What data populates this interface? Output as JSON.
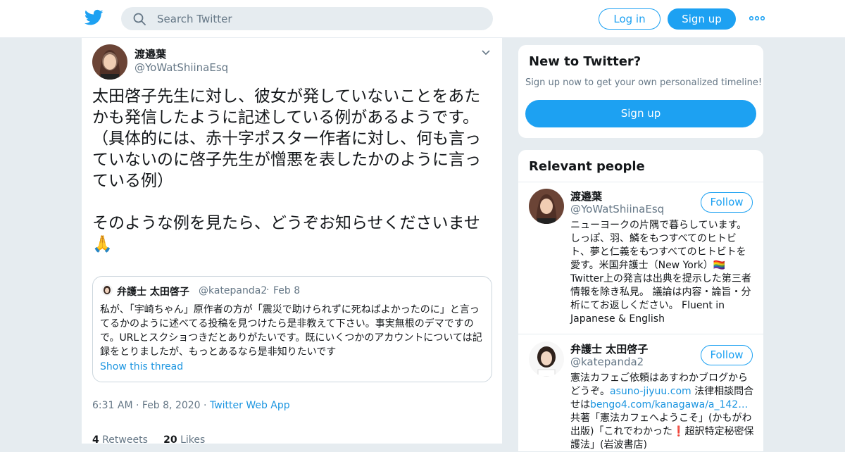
{
  "header": {
    "search_placeholder": "Search Twitter",
    "login_label": "Log in",
    "signup_label": "Sign up",
    "brand_color": "#1da1f2"
  },
  "tweet": {
    "author_name": "渡邉葉",
    "author_handle": "@YoWatShiinaEsq",
    "text": "太田啓子先生に対し、彼女が発していないことをあたかも発信したように記述している例があるようです。（具体的には、赤十字ポスター作者に対し、何も言っていないのに啓子先生が憎悪を表したかのように言っている例）\n\nそのような例を見たら、どうぞお知らせくださいませ🙏",
    "time": "6:31 AM",
    "date": "Feb 8, 2020",
    "source": "Twitter Web App",
    "retweets": "4",
    "retweets_label": "Retweets",
    "likes": "20",
    "likes_label": "Likes"
  },
  "quoted": {
    "name": "弁護士 太田啓子",
    "handle": "@katepanda2",
    "date": "Feb 8",
    "text": "私が、「宇崎ちゃん」原作者の方が「震災で助けられずに死ねばよかったのに」と言ってるかのように述べてる投稿を見つけたら是非教えて下さい。事実無根のデマですので。URLとスクショつきだとありがたいです。既にいくつかのアカウントについては記録をとりましたが、もっとあるなら是非知りたいです",
    "show_thread": "Show this thread"
  },
  "sidebar": {
    "new_title": "New to Twitter?",
    "new_sub": "Sign up now to get your own personalized timeline!",
    "signup_label": "Sign up",
    "relevant_title": "Relevant people",
    "follow_label": "Follow",
    "people": [
      {
        "name": "渡邉葉",
        "handle": "@YoWatShiinaEsq",
        "bio": "ニューヨークの片隅で暮らしています。しっぽ、羽、鱗をもつすべてのヒトビト、夢と仁義をもつすべてのヒトビトを愛す。米国弁護士（New York）🏳️‍🌈 Twitter上の発言は出典を提示した第三者情報を除き私見。 議論は内容・論旨・分析にてお返しください。 Fluent in Japanese & English"
      },
      {
        "name": "弁護士 太田啓子",
        "handle": "@katepanda2",
        "bio_1": "憲法カフェご依頼はあすわかブログからどうぞ。",
        "link_1": "asuno-jiyuu.com",
        "bio_2": " 法律相談問合せは",
        "link_2": "bengo4.com/kanagawa/a_142…",
        "bio_3": " 共著「憲法カフェへようこそ」(かもがわ出版)「これでわかった❗超訳特定秘密保護法」(岩波書店)"
      }
    ]
  }
}
